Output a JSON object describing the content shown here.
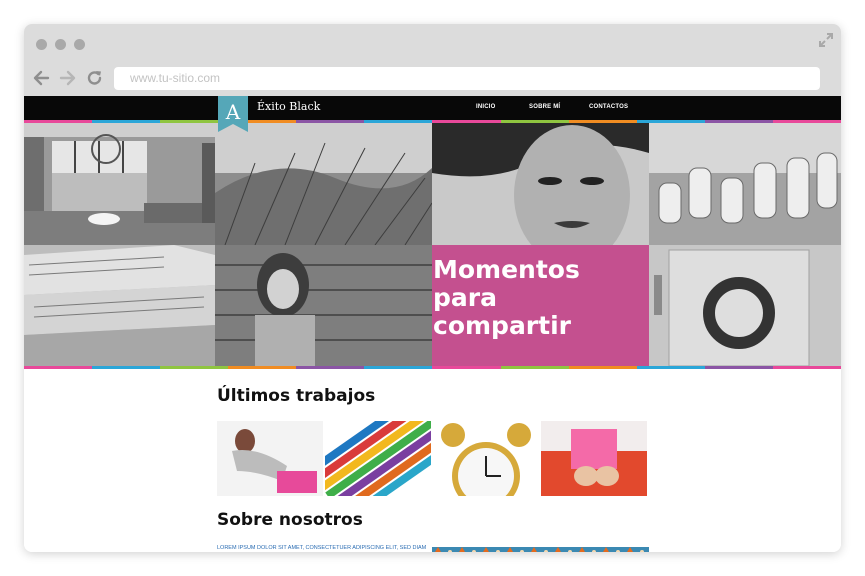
{
  "browser": {
    "url": "www.tu-sitio.com",
    "icons": [
      "back-arrow-icon",
      "forward-arrow-icon",
      "reload-icon",
      "expand-icon"
    ]
  },
  "site": {
    "brand": "Éxito Black",
    "logo_letter": "A",
    "nav": [
      "INICIO",
      "SOBRE MÍ",
      "CONTACTOS"
    ],
    "hero_title": "Momentos para compartir",
    "section_works": "Últimos trabajos",
    "section_about": "Sobre nosotros",
    "about_text": "LOREM IPSUM DOLOR SIT AMET, CONSECTETUER ADIPISCING ELIT, SED DIAM",
    "colors": {
      "accent_pink": "#c4508f",
      "logo_teal": "#55a7b8",
      "nav_bg": "#080808",
      "link_blue": "#2b6db3",
      "stripe": [
        "#e8499a",
        "#2ba6d8",
        "#8fc540",
        "#f08c22",
        "#8b55a5",
        "#2ba6d8",
        "#e8499a",
        "#8fc540",
        "#f08c22",
        "#2ba6d8",
        "#8b55a5",
        "#e8499a"
      ]
    }
  }
}
